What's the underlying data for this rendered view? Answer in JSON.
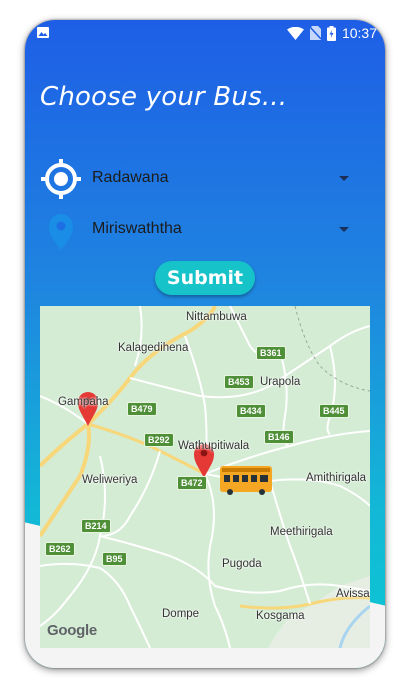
{
  "status_bar": {
    "time": "10:37"
  },
  "header": {
    "title": "Choose your Bus..."
  },
  "form": {
    "origin": {
      "value": "Radawana",
      "icon": "gps-target-icon"
    },
    "destination": {
      "value": "Miriswaththa",
      "icon": "location-pin-icon"
    },
    "submit_label": "Submit"
  },
  "map": {
    "places": {
      "nittambuwa": "Nittambuwa",
      "kalagedihena": "Kalagedihena",
      "urapola": "Urapola",
      "gampaha": "Gampaha",
      "weliweriya": "Weliweriya",
      "wathupitiwala": "Wathupitiwala",
      "amithirigala": "Amithirigala",
      "meethirigala": "Meethirigala",
      "pugoda": "Pugoda",
      "dompe": "Dompe",
      "kosgama": "Kosgama",
      "avissawella": "Avissa"
    },
    "roads": {
      "b361": "B361",
      "b453": "B453",
      "b479": "B479",
      "b434": "B434",
      "b445": "B445",
      "b292": "B292",
      "b146": "B146",
      "b472": "B472",
      "b214": "B214",
      "b262": "B262",
      "b95": "B95"
    },
    "attribution": "Google",
    "colors": {
      "land": "#d4ecd4",
      "road": "#ffffff",
      "highway": "#f7d77a",
      "marker": "#e53935",
      "bus": "#f5a623"
    }
  }
}
